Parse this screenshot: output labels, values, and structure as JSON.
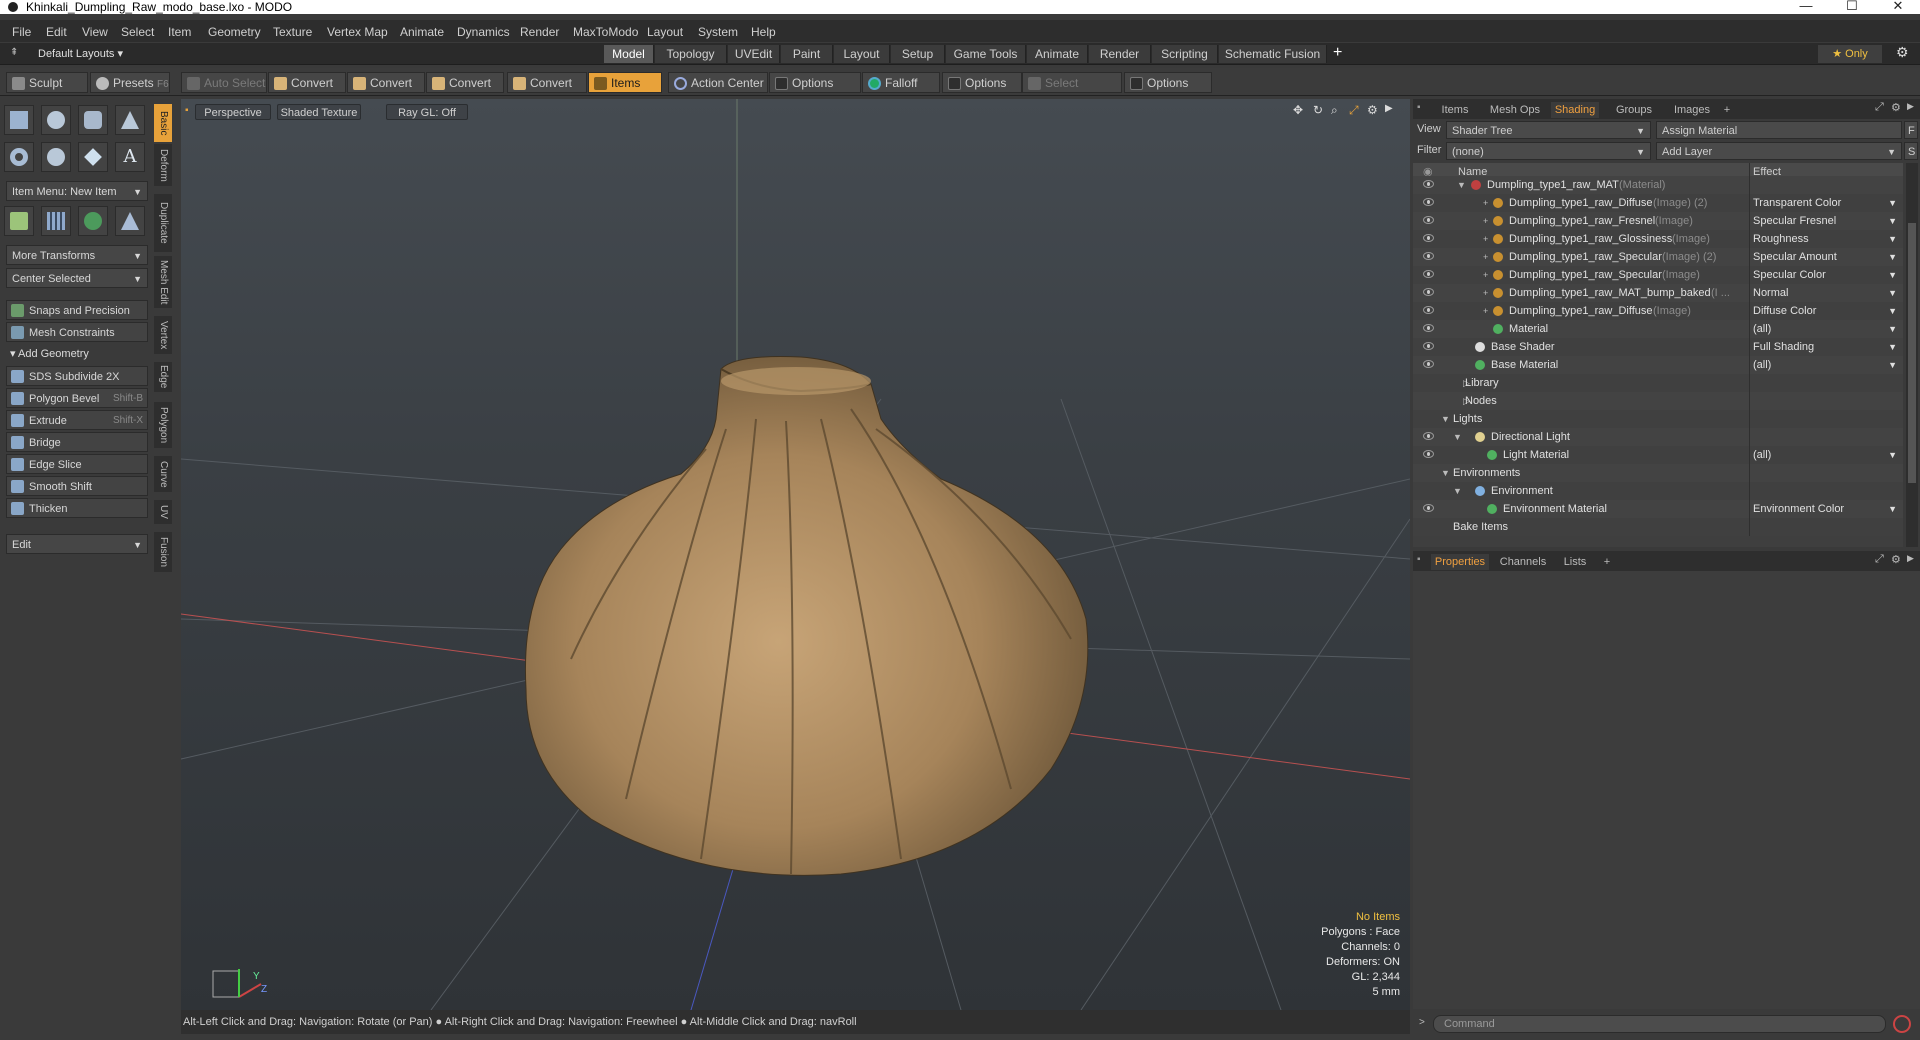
{
  "window": {
    "title": "Khinkali_Dumpling_Raw_modo_base.lxo - MODO",
    "minimize": "—",
    "maximize": "☐",
    "close": "✕"
  },
  "menu": [
    "File",
    "Edit",
    "View",
    "Select",
    "Item",
    "Geometry",
    "Texture",
    "Vertex Map",
    "Animate",
    "Dynamics",
    "Render",
    "MaxToModo",
    "Layout",
    "System",
    "Help"
  ],
  "layouts": {
    "selector": "Default Layouts ▾",
    "tabs": [
      "Model",
      "Topology",
      "UVEdit",
      "Paint",
      "Layout",
      "Setup",
      "Game Tools",
      "Animate",
      "Render",
      "Scripting",
      "Schematic Fusion"
    ],
    "active": "Model",
    "add": "+",
    "only": "★  Only",
    "gear": "⚙"
  },
  "toolbar": {
    "sculpt": "Sculpt",
    "presets": "Presets",
    "presets_key": "F6",
    "auto_select": "Auto Select",
    "convert1": "Convert",
    "convert2": "Convert",
    "convert3": "Convert",
    "convert4": "Convert",
    "items": "Items",
    "action_center": "Action Center",
    "options1": "Options",
    "falloff": "Falloff",
    "options2": "Options",
    "select_through": "Select Through",
    "options3": "Options"
  },
  "left": {
    "item_menu": "Item Menu: New Item",
    "more_transforms": "More Transforms",
    "center_selected": "Center Selected",
    "snaps": "Snaps and Precision",
    "mesh_constraints": "Mesh Constraints",
    "add_geometry": "Add Geometry",
    "sds": "SDS Subdivide 2X",
    "polygon_bevel": "Polygon Bevel",
    "polygon_bevel_key": "Shift-B",
    "extrude": "Extrude",
    "extrude_key": "Shift-X",
    "bridge": "Bridge",
    "edge_slice": "Edge Slice",
    "smooth_shift": "Smooth Shift",
    "thicken": "Thicken",
    "edit": "Edit"
  },
  "vtabs": [
    "Basic",
    "Deform",
    "Duplicate",
    "Mesh Edit",
    "Vertex",
    "Edge",
    "Polygon",
    "Curve",
    "UV",
    "Fusion"
  ],
  "viewport": {
    "perspective": "Perspective",
    "shaded": "Shaded Texture",
    "raygl": "Ray GL: Off",
    "info": {
      "items": "No Items",
      "polygons": "Polygons : Face",
      "channels": "Channels: 0",
      "deformers": "Deformers: ON",
      "gl": "GL: 2,344",
      "scale": "5 mm"
    }
  },
  "status": "Alt-Left Click and Drag: Navigation: Rotate (or Pan) ● Alt-Right Click and Drag: Navigation: Freewheel ● Alt-Middle Click and Drag: navRoll",
  "right": {
    "tabs": [
      "Items",
      "Mesh Ops",
      "Shading",
      "Groups",
      "Images"
    ],
    "active_tab": "Shading",
    "add": "+",
    "view_label": "View",
    "view_value": "Shader Tree",
    "assign": "Assign Material",
    "f_btn": "F",
    "filter_label": "Filter",
    "filter_value": "(none)",
    "add_layer": "Add Layer",
    "s_btn": "S",
    "col_name": "Name",
    "col_effect": "Effect",
    "rows": [
      {
        "name": "Dumpling_type1_raw_MAT",
        "sub": " (Material)",
        "effect": ""
      },
      {
        "name": "Dumpling_type1_raw_Diffuse",
        "sub": " (Image) (2)",
        "effect": "Transparent Color"
      },
      {
        "name": "Dumpling_type1_raw_Fresnel",
        "sub": " (Image)",
        "effect": "Specular Fresnel"
      },
      {
        "name": "Dumpling_type1_raw_Glossiness",
        "sub": " (Image)",
        "effect": "Roughness"
      },
      {
        "name": "Dumpling_type1_raw_Specular",
        "sub": " (Image) (2)",
        "effect": "Specular Amount"
      },
      {
        "name": "Dumpling_type1_raw_Specular",
        "sub": " (Image)",
        "effect": "Specular Color"
      },
      {
        "name": "Dumpling_type1_raw_MAT_bump_baked",
        "sub": " (I ...",
        "effect": "Normal"
      },
      {
        "name": "Dumpling_type1_raw_Diffuse",
        "sub": " (Image)",
        "effect": "Diffuse Color"
      },
      {
        "name": "Material",
        "sub": "",
        "effect": "(all)"
      },
      {
        "name": "Base Shader",
        "sub": "",
        "effect": "Full Shading"
      },
      {
        "name": "Base Material",
        "sub": "",
        "effect": "(all)"
      },
      {
        "name": "Library",
        "sub": "",
        "effect": ""
      },
      {
        "name": "Nodes",
        "sub": "",
        "effect": ""
      },
      {
        "name": "Lights",
        "sub": "",
        "effect": ""
      },
      {
        "name": "Directional Light",
        "sub": "",
        "effect": ""
      },
      {
        "name": "Light Material",
        "sub": "",
        "effect": "(all)"
      },
      {
        "name": "Environments",
        "sub": "",
        "effect": ""
      },
      {
        "name": "Environment",
        "sub": "",
        "effect": ""
      },
      {
        "name": "Environment Material",
        "sub": "",
        "effect": "Environment Color"
      },
      {
        "name": "Bake Items",
        "sub": "",
        "effect": ""
      }
    ],
    "props_tabs": [
      "Properties",
      "Channels",
      "Lists"
    ],
    "props_active": "Properties",
    "command": "Command"
  }
}
